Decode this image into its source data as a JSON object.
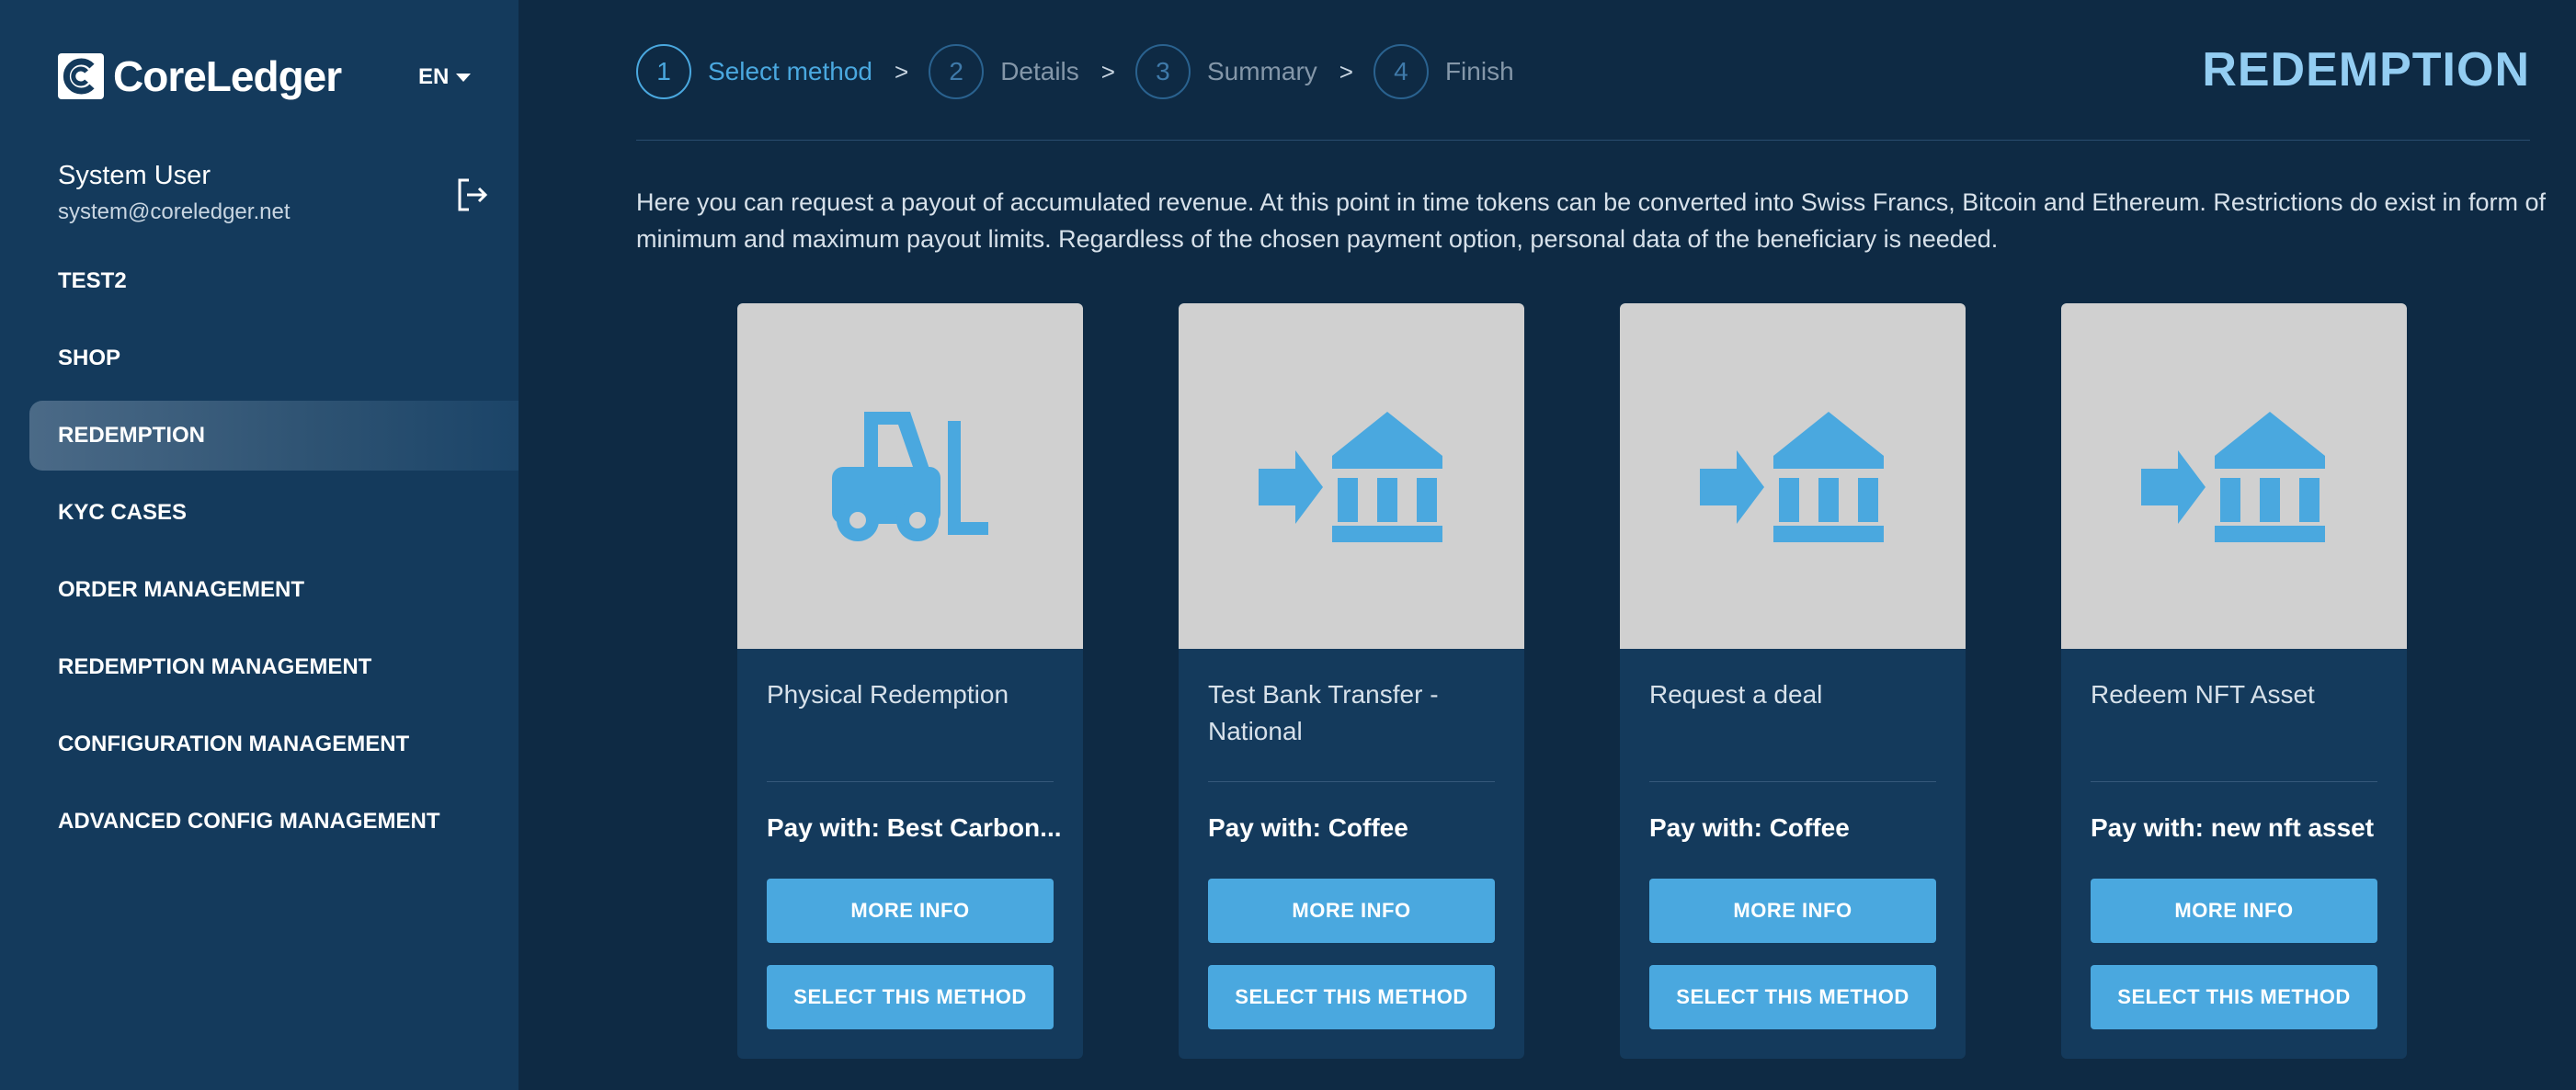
{
  "brand": {
    "name": "CoreLedger",
    "accent": "#4aa8df"
  },
  "language": {
    "selected": "EN"
  },
  "user": {
    "name": "System User",
    "email": "system@coreledger.net"
  },
  "nav": {
    "items": [
      {
        "label": "TEST2",
        "active": false
      },
      {
        "label": "SHOP",
        "active": false
      },
      {
        "label": "REDEMPTION",
        "active": true
      },
      {
        "label": "KYC CASES",
        "active": false
      },
      {
        "label": "ORDER MANAGEMENT",
        "active": false
      },
      {
        "label": "REDEMPTION MANAGEMENT",
        "active": false
      },
      {
        "label": "CONFIGURATION MANAGEMENT",
        "active": false
      },
      {
        "label": "ADVANCED CONFIG MANAGEMENT",
        "active": false
      }
    ]
  },
  "stepper": {
    "steps": [
      {
        "num": "1",
        "label": "Select method",
        "active": true
      },
      {
        "num": "2",
        "label": "Details",
        "active": false
      },
      {
        "num": "3",
        "label": "Summary",
        "active": false
      },
      {
        "num": "4",
        "label": "Finish",
        "active": false
      }
    ],
    "separator": ">"
  },
  "page": {
    "title": "REDEMPTION",
    "intro": "Here you can request a payout of accumulated revenue. At this point in time tokens can be converted into Swiss Francs, Bitcoin and Ethereum. Restrictions do exist in form of minimum and maximum payout limits. Regardless of the chosen payment option, personal data of the beneficiary is needed."
  },
  "methods": [
    {
      "title": "Physical Redemption",
      "pay": "Pay with: Best Carbon...",
      "icon": "forklift-icon",
      "more_label": "MORE INFO",
      "select_label": "SELECT THIS METHOD"
    },
    {
      "title": "Test Bank Transfer - National",
      "pay": "Pay with: Coffee",
      "icon": "bank-transfer-icon",
      "more_label": "MORE INFO",
      "select_label": "SELECT THIS METHOD"
    },
    {
      "title": "Request a deal",
      "pay": "Pay with: Coffee",
      "icon": "bank-transfer-icon",
      "more_label": "MORE INFO",
      "select_label": "SELECT THIS METHOD"
    },
    {
      "title": "Redeem NFT Asset",
      "pay": "Pay with: new nft asset",
      "icon": "bank-transfer-icon",
      "more_label": "MORE INFO",
      "select_label": "SELECT THIS METHOD"
    }
  ]
}
